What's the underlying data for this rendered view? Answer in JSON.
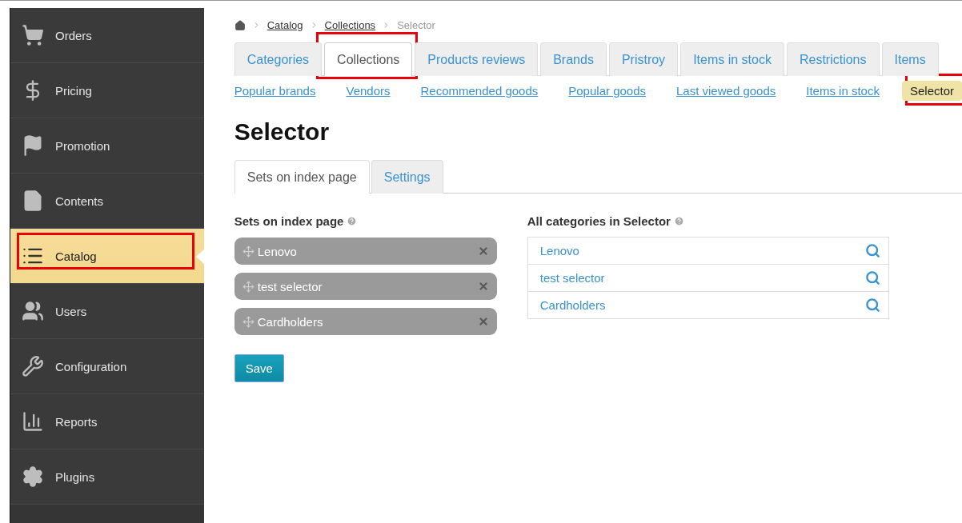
{
  "sidebar": {
    "items": [
      {
        "label": "Orders",
        "selected": false,
        "highlighted": false
      },
      {
        "label": "Pricing",
        "selected": false,
        "highlighted": false
      },
      {
        "label": "Promotion",
        "selected": false,
        "highlighted": false
      },
      {
        "label": "Contents",
        "selected": false,
        "highlighted": false
      },
      {
        "label": "Catalog",
        "selected": true,
        "highlighted": true
      },
      {
        "label": "Users",
        "selected": false,
        "highlighted": false
      },
      {
        "label": "Configuration",
        "selected": false,
        "highlighted": false
      },
      {
        "label": "Reports",
        "selected": false,
        "highlighted": false
      },
      {
        "label": "Plugins",
        "selected": false,
        "highlighted": false
      }
    ]
  },
  "breadcrumb": [
    {
      "label": "Catalog",
      "link": true
    },
    {
      "label": "Collections",
      "link": true
    },
    {
      "label": "Selector",
      "link": false
    }
  ],
  "tabs": [
    {
      "label": "Categories",
      "selected": false,
      "highlighted": false
    },
    {
      "label": "Collections",
      "selected": true,
      "highlighted": true
    },
    {
      "label": "Products reviews",
      "selected": false,
      "highlighted": false
    },
    {
      "label": "Brands",
      "selected": false,
      "highlighted": false
    },
    {
      "label": "Pristroy",
      "selected": false,
      "highlighted": false
    },
    {
      "label": "Items in stock",
      "selected": false,
      "highlighted": false
    },
    {
      "label": "Restrictions",
      "selected": false,
      "highlighted": false
    },
    {
      "label": "Items",
      "selected": false,
      "highlighted": false
    }
  ],
  "subtabs": [
    {
      "label": "Popular brands",
      "selected": false,
      "highlighted": false
    },
    {
      "label": "Vendors",
      "selected": false,
      "highlighted": false
    },
    {
      "label": "Recommended goods",
      "selected": false,
      "highlighted": false
    },
    {
      "label": "Popular goods",
      "selected": false,
      "highlighted": false
    },
    {
      "label": "Last viewed goods",
      "selected": false,
      "highlighted": false
    },
    {
      "label": "Items in stock",
      "selected": false,
      "highlighted": false
    },
    {
      "label": "Selector",
      "selected": true,
      "highlighted": true
    }
  ],
  "title": "Selector",
  "inner_tabs": [
    {
      "label": "Sets on index page",
      "selected": true
    },
    {
      "label": "Settings",
      "selected": false
    }
  ],
  "sets": {
    "heading": "Sets on index page",
    "items": [
      "Lenovo",
      "test selector",
      "Cardholders"
    ]
  },
  "categories": {
    "heading": "All categories in Selector",
    "items": [
      "Lenovo",
      "test selector",
      "Cardholders"
    ]
  },
  "save_button": "Save"
}
